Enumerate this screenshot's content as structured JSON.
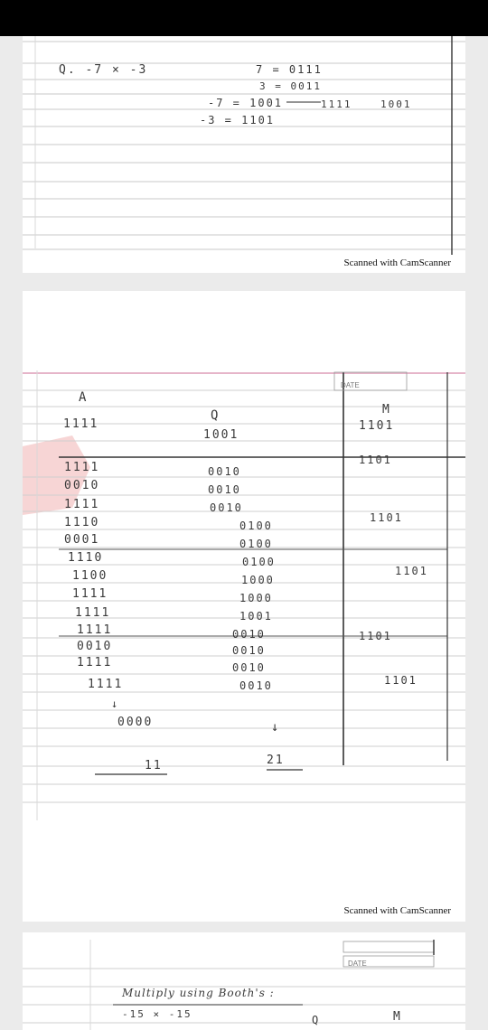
{
  "page1": {
    "lines": [
      "Q. -7 × -3",
      "7 = 0111",
      "3 = 0011",
      "-7 = 1001",
      "1111",
      "1001",
      "-3 = 1101"
    ],
    "footer": "Scanned with CamScanner"
  },
  "page2": {
    "col_a_header": "A",
    "col_q_header": "Q",
    "col_m_header": "M",
    "col_a": [
      "1111",
      "1111",
      "0010",
      "1111",
      "1110",
      "0001",
      "1110",
      "1100",
      "1111",
      "1111",
      "1111",
      "0010",
      "1111",
      "1111",
      "↓",
      "0000"
    ],
    "col_q": [
      "1001",
      "0010",
      "0010",
      "0010",
      "0100",
      "0100",
      "0100",
      "1000",
      "1000",
      "1001",
      "0010",
      "0010",
      "0010",
      "0010",
      "↓"
    ],
    "col_m": [
      "1101",
      "1101",
      "1101",
      "1101",
      "1101",
      "1101"
    ],
    "result_a": "11",
    "result_q": "21",
    "date_label": "DATE",
    "footer": "Scanned with CamScanner"
  },
  "page3": {
    "heading": "Multiply using Booth's :",
    "subline": "-15 × -15",
    "date_label": "DATE",
    "m_label": "M",
    "q_label": "Q"
  }
}
